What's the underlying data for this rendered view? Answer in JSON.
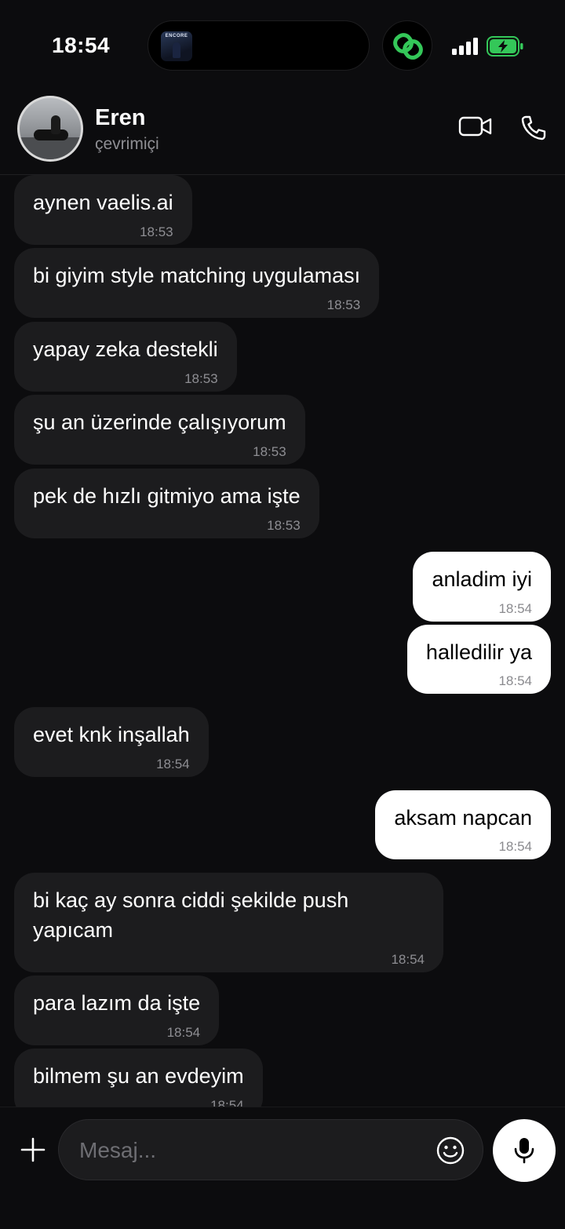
{
  "status_bar": {
    "time": "18:54",
    "album_label": "ENCORE"
  },
  "contact": {
    "name": "Eren",
    "status": "çevrimiçi"
  },
  "messages": [
    {
      "side": "in",
      "text": "aynen vaelis.ai",
      "time": "18:53"
    },
    {
      "side": "in",
      "text": "bi giyim style matching uygulaması",
      "time": "18:53"
    },
    {
      "side": "in",
      "text": "yapay zeka destekli",
      "time": "18:53"
    },
    {
      "side": "in",
      "text": "şu an üzerinde çalışıyorum",
      "time": "18:53"
    },
    {
      "side": "in",
      "text": "pek de hızlı gitmiyo ama işte",
      "time": "18:53"
    },
    {
      "side": "out",
      "text": "anladim iyi",
      "time": "18:54"
    },
    {
      "side": "out",
      "text": "halledilir ya",
      "time": "18:54"
    },
    {
      "side": "in",
      "text": "evet knk inşallah",
      "time": "18:54"
    },
    {
      "side": "out",
      "text": "aksam napcan",
      "time": "18:54"
    },
    {
      "side": "in",
      "text": "bi kaç ay sonra ciddi şekilde push yapıcam",
      "time": "18:54"
    },
    {
      "side": "in",
      "text": "para lazım da işte",
      "time": "18:54"
    },
    {
      "side": "in",
      "text": "bilmem şu an evdeyim",
      "time": "18:54"
    }
  ],
  "composer": {
    "placeholder": "Mesaj..."
  },
  "colors": {
    "background": "#0c0c0e",
    "incoming_bubble": "#1c1c1e",
    "outgoing_bubble": "#ffffff",
    "accent_green": "#34c759"
  }
}
